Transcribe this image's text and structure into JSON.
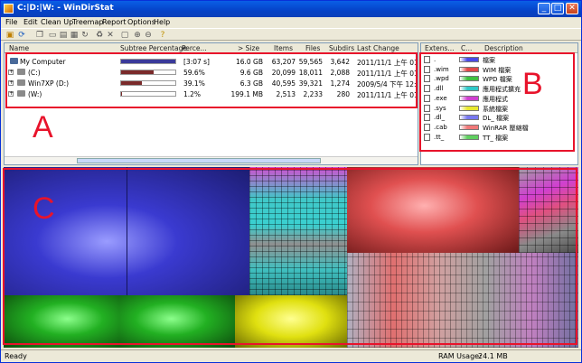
{
  "window": {
    "title": "C:|D:|W: - WinDirStat"
  },
  "menu": [
    "File",
    "Edit",
    "Clean Up",
    "Treemap",
    "Report",
    "Options",
    "Help"
  ],
  "toolbar_icons": [
    "open-icon",
    "refresh-icon",
    "copy-icon",
    "open-item-icon",
    "explorer-icon",
    "cmd-icon",
    "refresh-selected-icon",
    "recycle-icon",
    "delete-icon",
    "properties-icon",
    "zoom-in-icon",
    "zoom-out-icon",
    "help-icon"
  ],
  "dir_columns": [
    "Name",
    "Subtree Percentage",
    "Perce...",
    "> Size",
    "Items",
    "Files",
    "Subdirs",
    "Last Change"
  ],
  "dir_rows": [
    {
      "toggle": "",
      "name": "My Computer",
      "pct": "[3:07 s]",
      "size": "16.0 GB",
      "items": "63,207",
      "files": "59,565",
      "subdirs": "3,642",
      "last": "2011/11/1 上午 01:...",
      "bar": 1.0,
      "bar_color": "#3a3a9a"
    },
    {
      "toggle": "+",
      "name": "(C:)",
      "pct": "59.6%",
      "size": "9.6 GB",
      "items": "20,099",
      "files": "18,011",
      "subdirs": "2,088",
      "last": "2011/11/1 上午 01:...",
      "bar": 0.596,
      "bar_color": "#7a2a2a"
    },
    {
      "toggle": "+",
      "name": "Win7XP (D:)",
      "pct": "39.1%",
      "size": "6.3 GB",
      "items": "40,595",
      "files": "39,321",
      "subdirs": "1,274",
      "last": "2009/5/4 下午 12:3...",
      "bar": 0.391,
      "bar_color": "#7a2a2a"
    },
    {
      "toggle": "+",
      "name": "(W:)",
      "pct": "1.2%",
      "size": "199.1 MB",
      "items": "2,513",
      "files": "2,233",
      "subdirs": "280",
      "last": "2011/11/1 上午 01:...",
      "bar": 0.012,
      "bar_color": "#7a2a2a"
    }
  ],
  "ext_columns": [
    "Extens...",
    "C...",
    "Description"
  ],
  "ext_rows": [
    {
      "ext": ".",
      "color": "#4a4ae6",
      "desc": "檔案"
    },
    {
      "ext": ".wim",
      "color": "#e04848",
      "desc": "WIM 檔案"
    },
    {
      "ext": ".wpd",
      "color": "#40c040",
      "desc": "WPD 檔案"
    },
    {
      "ext": ".dll",
      "color": "#30c8c8",
      "desc": "應用程式擴充"
    },
    {
      "ext": ".exe",
      "color": "#d040d0",
      "desc": "應用程式"
    },
    {
      "ext": ".sys",
      "color": "#e8e830",
      "desc": "系統檔案"
    },
    {
      "ext": ".dl_",
      "color": "#7878f0",
      "desc": "DL_ 檔案"
    },
    {
      "ext": ".cab",
      "color": "#f07878",
      "desc": "WinRAR 壓縮檔"
    },
    {
      "ext": ".tt_",
      "color": "#60d060",
      "desc": "TT_ 檔案"
    }
  ],
  "status": {
    "left": "Ready",
    "ram_label": "RAM Usage:",
    "ram_value": "24.1 MB"
  },
  "annotations": {
    "a": "A",
    "b": "B",
    "c": "C"
  }
}
